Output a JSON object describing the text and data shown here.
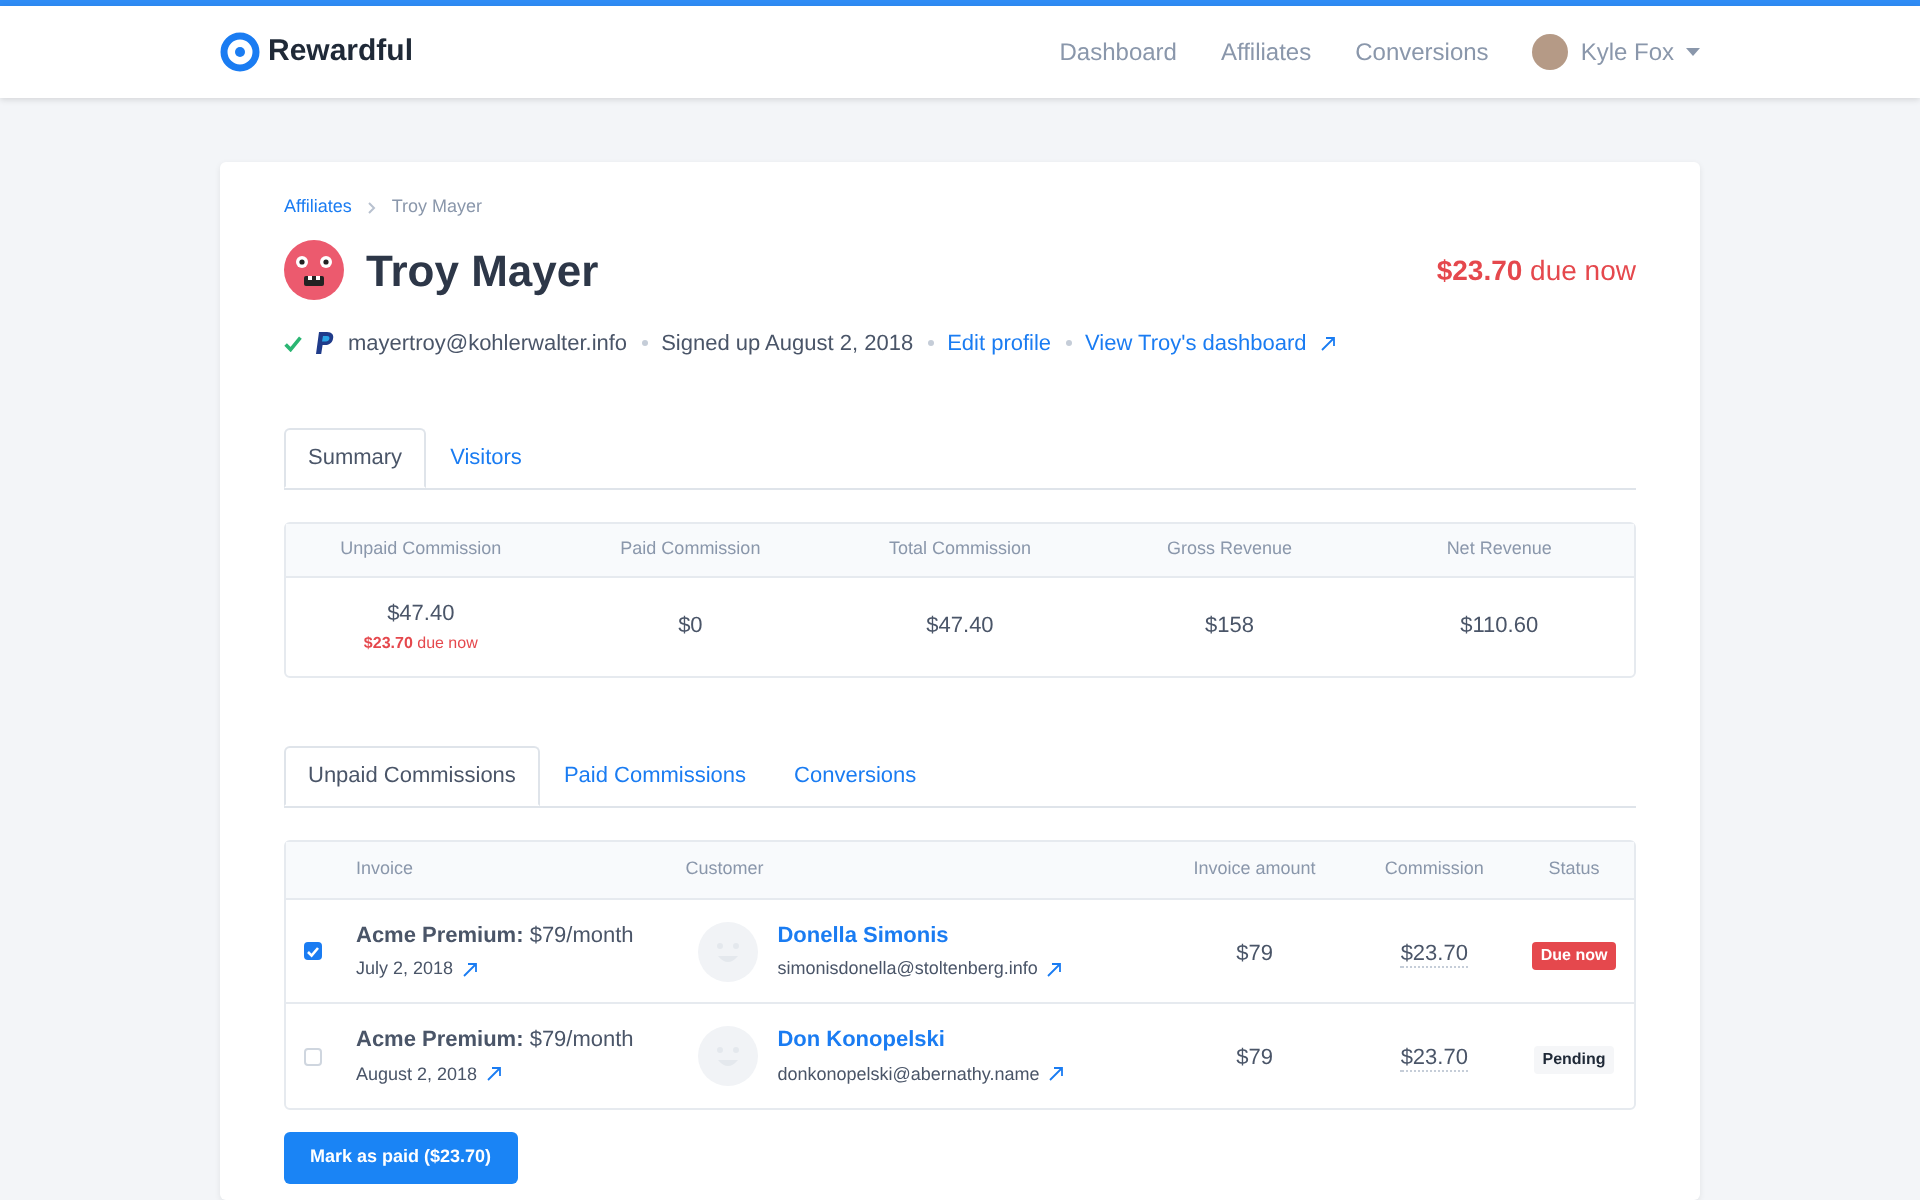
{
  "nav": {
    "brand": "Rewardful",
    "links": [
      {
        "label": "Dashboard"
      },
      {
        "label": "Affiliates"
      },
      {
        "label": "Conversions"
      }
    ],
    "user": "Kyle Fox"
  },
  "breadcrumb": [
    "Affiliates",
    "Troy Mayer"
  ],
  "affiliate": {
    "name": "Troy Mayer",
    "due": "**$23.70** due now",
    "verified": true,
    "email": "mayertroy@kohlerwalter.info",
    "signed_up": "Signed up August 2, 2018",
    "links": [
      "Edit profile",
      "View Troy's dashboard"
    ]
  },
  "tabs": [
    {
      "label": "Summary",
      "selected": true
    },
    {
      "label": "Visitors",
      "selected": false
    }
  ],
  "summary": {
    "columns": [
      "Unpaid Commission",
      "Paid Commission",
      "Total Commission",
      "Gross Revenue",
      "Net Revenue"
    ],
    "values": [
      {
        "value": "$47.40",
        "note": "**$23.70** due now"
      },
      {
        "value": "$0"
      },
      {
        "value": "$47.40"
      },
      {
        "value": "$158"
      },
      {
        "value": "$110.60"
      }
    ]
  },
  "commission_tabs": [
    {
      "label": "Unpaid Commissions",
      "selected": true
    },
    {
      "label": "Paid Commissions",
      "selected": false
    },
    {
      "label": "Conversions",
      "selected": false
    }
  ],
  "table": {
    "columns": [
      "Invoice",
      "Customer",
      "Invoice amount",
      "Commission",
      "Status"
    ],
    "rows": [
      {
        "checked": true,
        "invoice": "**Acme Premium:** $79/month",
        "date": "July 2, 2018",
        "customer": "Donella Simonis",
        "email": "simonisdonella@stoltenberg.info",
        "amount": "$79",
        "commission": "$23.70",
        "status": {
          "kind": "due",
          "label": "Due now"
        }
      },
      {
        "checked": false,
        "invoice": "**Acme Premium:** $79/month",
        "date": "August 2, 2018",
        "customer": "Don Konopelski",
        "email": "donkonopelski@abernathy.name",
        "amount": "$79",
        "commission": "$23.70",
        "status": {
          "kind": "pending",
          "label": "Pending"
        }
      }
    ]
  },
  "action_button": "Mark as paid ($23.70)"
}
